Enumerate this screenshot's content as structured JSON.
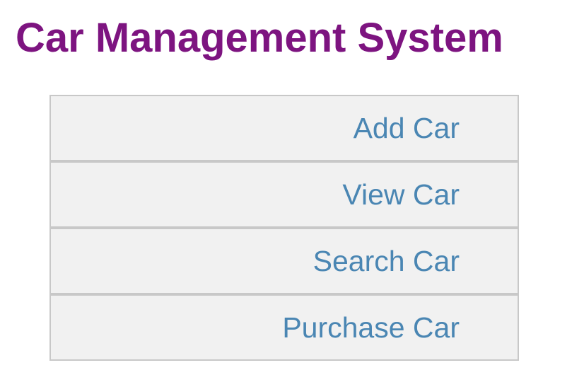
{
  "page": {
    "title": "Car Management System"
  },
  "menu": {
    "items": [
      {
        "label": "Add Car"
      },
      {
        "label": "View Car"
      },
      {
        "label": "Search Car"
      },
      {
        "label": "Purchase Car"
      }
    ]
  },
  "colors": {
    "title": "#7d1480",
    "link": "#4a86b3",
    "item_background": "#f1f1f1",
    "item_border": "#c8c8c8"
  }
}
